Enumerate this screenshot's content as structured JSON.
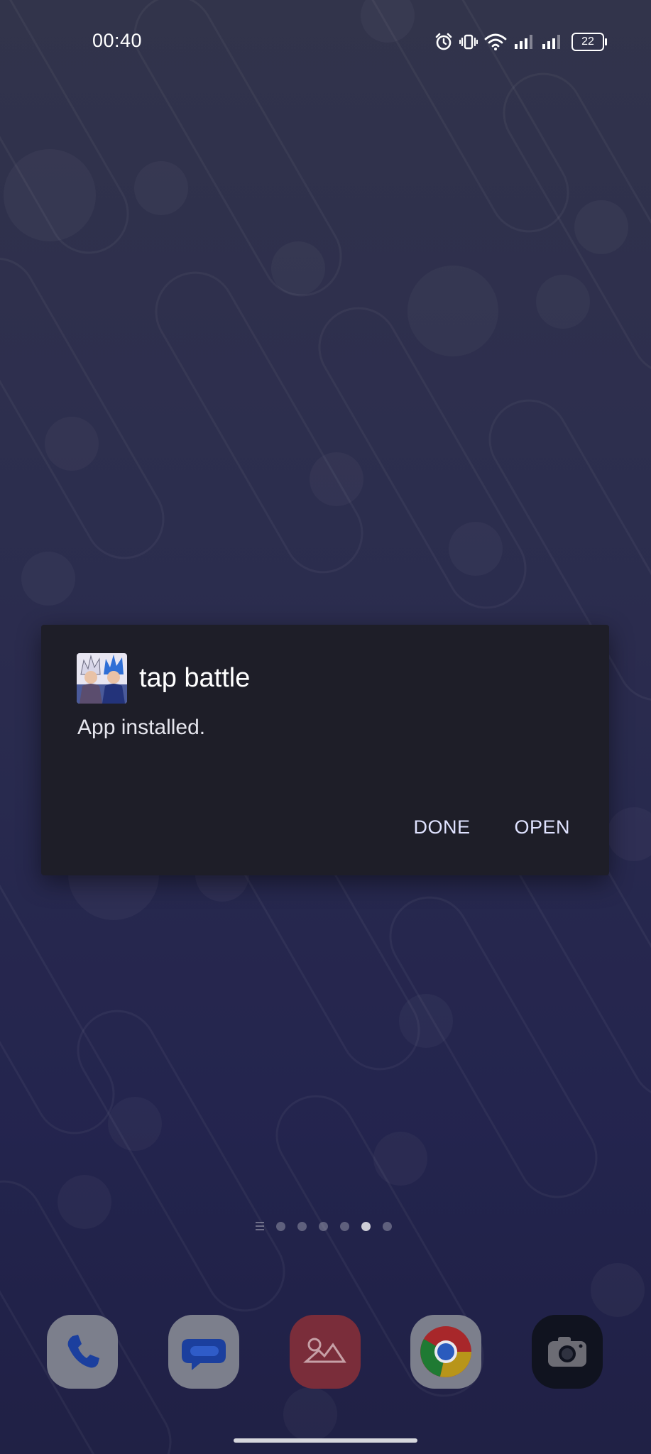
{
  "status_bar": {
    "time": "00:40",
    "battery_level": "22",
    "icons": [
      "alarm-icon",
      "vibrate-icon",
      "wifi-icon",
      "signal-sim1-icon",
      "signal-sim2-icon",
      "battery-icon"
    ]
  },
  "dialog": {
    "app_name": "tap battle",
    "message": "App installed.",
    "done_label": "DONE",
    "open_label": "OPEN",
    "background_color": "#1e1e28",
    "button_color": "#dfe2ff"
  },
  "home": {
    "page_count": 6,
    "active_page": 5,
    "dock_apps": [
      "phone",
      "messages",
      "gallery",
      "chrome",
      "camera"
    ]
  }
}
